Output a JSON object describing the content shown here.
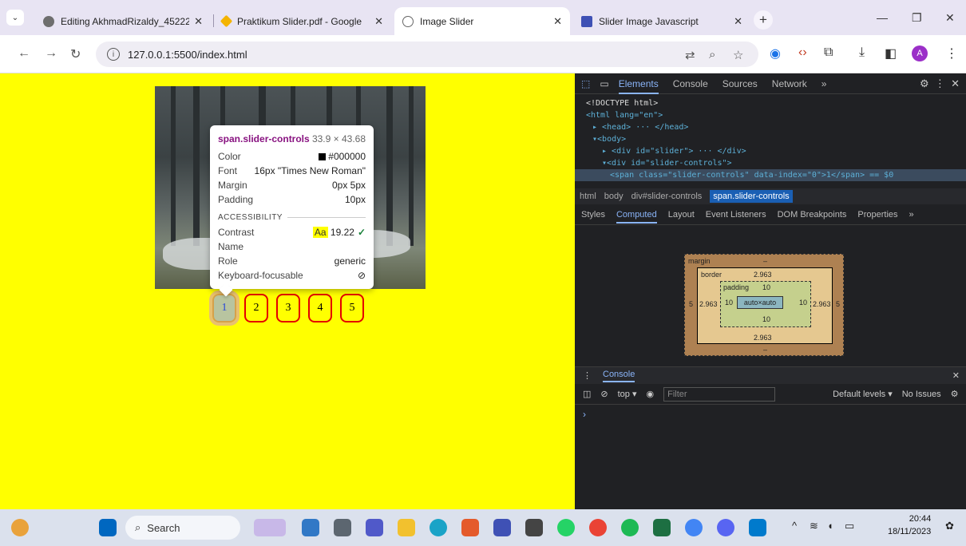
{
  "browser": {
    "tabs": [
      {
        "title": "Editing AkhmadRizaldy_45222",
        "icon": "github-icon",
        "color": "#6e6e6e"
      },
      {
        "title": "Praktikum Slider.pdf - Google",
        "icon": "google-drive-icon",
        "color": "#f4b400"
      },
      {
        "title": "Image Slider",
        "icon": "globe-icon",
        "color": "#666666"
      },
      {
        "title": "Slider Image Javascript",
        "icon": "slides-icon",
        "color": "#3f51b5"
      }
    ],
    "url": "127.0.0.1:5500/index.html"
  },
  "page": {
    "background": "#ffff00",
    "controls": [
      "1",
      "2",
      "3",
      "4",
      "5"
    ]
  },
  "tooltip": {
    "title": "span.slider-controls",
    "dimensions": "33.9 × 43.68",
    "rows": [
      {
        "k": "Color",
        "v": "#000000"
      },
      {
        "k": "Font",
        "v": "16px \"Times New Roman\""
      },
      {
        "k": "Margin",
        "v": "0px 5px"
      },
      {
        "k": "Padding",
        "v": "10px"
      }
    ],
    "section": "ACCESSIBILITY",
    "contrast_label": "Contrast",
    "contrast_sample": "Aa",
    "contrast_value": "19.22",
    "name_label": "Name",
    "role_label": "Role",
    "role_value": "generic",
    "focus_label": "Keyboard-focusable"
  },
  "devtools": {
    "tabs": [
      "Elements",
      "Console",
      "Sources",
      "Network"
    ],
    "dom": {
      "doctype": "<!DOCTYPE html>",
      "html_open": "<html lang=\"en\">",
      "head": "<head> ··· </head>",
      "body": "<body>",
      "slider": "<div id=\"slider\"> ··· </div>",
      "controls": "<div id=\"slider-controls\">",
      "selected": "<span class=\"slider-controls\" data-index=\"0\">1</span> == $0"
    },
    "breadcrumbs": [
      "html",
      "body",
      "div#slider-controls",
      "span.slider-controls"
    ],
    "subtabs": [
      "Styles",
      "Computed",
      "Layout",
      "Event Listeners",
      "DOM Breakpoints",
      "Properties"
    ],
    "boxmodel": {
      "margin_label": "margin",
      "margin_top": "–",
      "margin_bottom": "–",
      "margin_left": "5",
      "margin_right": "5",
      "border_label": "border",
      "border_val": "2.963",
      "padding_label": "padding",
      "padding_val": "10",
      "content": "auto×auto"
    },
    "console": {
      "label": "Console",
      "context": "top",
      "filter_placeholder": "Filter",
      "levels": "Default levels",
      "issues": "No Issues"
    }
  },
  "taskbar": {
    "search_label": "Search",
    "time": "20:44",
    "date": "18/11/2023"
  }
}
